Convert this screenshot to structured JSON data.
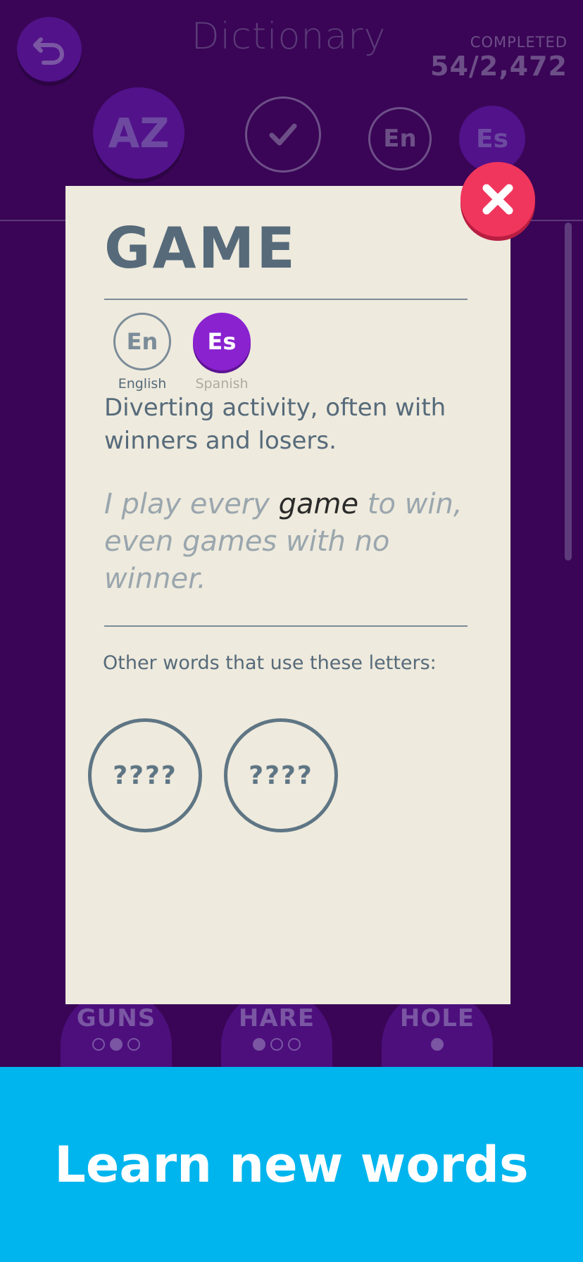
{
  "header": {
    "title": "Dictionary",
    "completed_label": "COMPLETED",
    "completed_value": "54/2,472"
  },
  "filters": {
    "az": "AZ",
    "en": "En",
    "es": "Es"
  },
  "background_words": [
    {
      "word": "GUNS"
    },
    {
      "word": "HARE"
    },
    {
      "word": "HOLE"
    }
  ],
  "card": {
    "word": "GAME",
    "languages": [
      {
        "code": "En",
        "name": "English"
      },
      {
        "code": "Es",
        "name": "Spanish"
      }
    ],
    "definition": "Diverting activity, often with winners and losers.",
    "example": {
      "before": "I play every ",
      "highlight": "game",
      "after": " to win, even games with no winner."
    },
    "other_words_label": "Other words that use these letters:",
    "other_words": [
      "????",
      "????"
    ]
  },
  "banner": {
    "text": "Learn new words"
  },
  "colors": {
    "background": "#3a0556",
    "card": "#eeeadd",
    "close": "#f0365d",
    "spanish_active": "#8a22d0",
    "banner": "#00b5ee"
  }
}
